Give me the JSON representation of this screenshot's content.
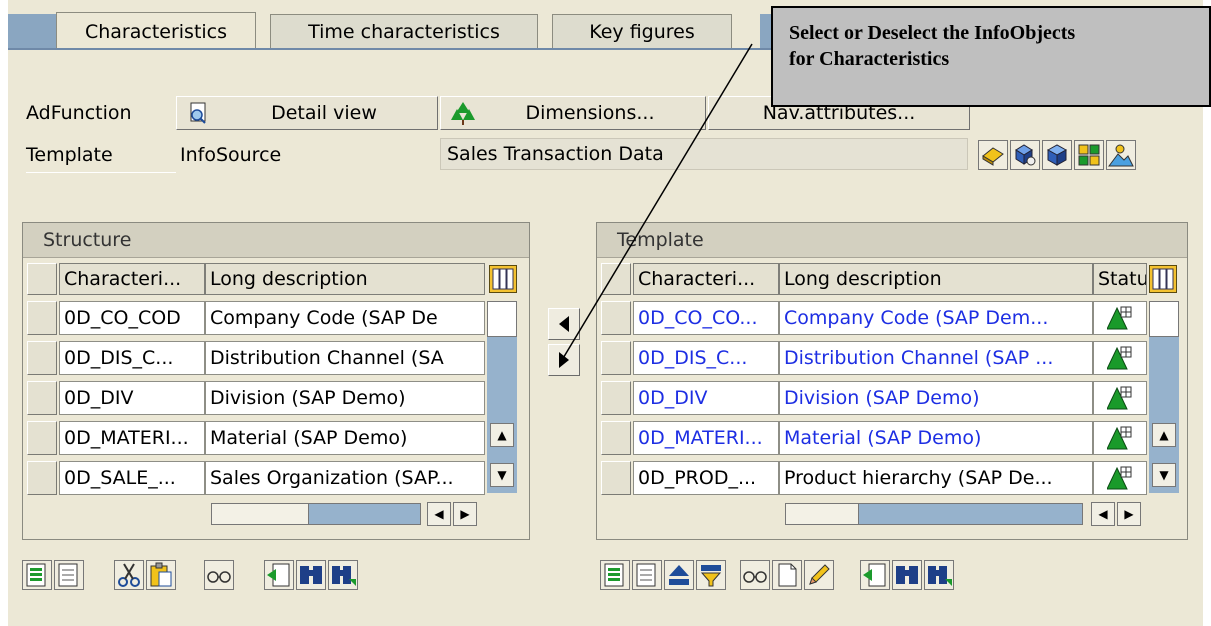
{
  "tabs": [
    {
      "label": "Characteristics",
      "active": true
    },
    {
      "label": "Time characteristics",
      "active": false
    },
    {
      "label": "Key figures",
      "active": false
    }
  ],
  "callout": {
    "line1": "Select or Deselect the InfoObjects",
    "line2": "for Characteristics"
  },
  "adfunction": {
    "label": "AdFunction",
    "detail_view": "Detail view",
    "dimensions": "Dimensions...",
    "nav_attributes": "Nav.attributes..."
  },
  "template_row": {
    "label": "Template",
    "type": "InfoSource",
    "value": "Sales Transaction Data"
  },
  "structure": {
    "title": "Structure",
    "columns": [
      "Characteri...",
      "Long description"
    ],
    "rows": [
      [
        "0D_CO_COD",
        "Company Code (SAP De"
      ],
      [
        "0D_DIS_C...",
        "Distribution Channel (SA"
      ],
      [
        "0D_DIV",
        "Division (SAP Demo)"
      ],
      [
        "0D_MATERI...",
        "Material (SAP Demo)"
      ],
      [
        "0D_SALE_...",
        "Sales Organization (SAP..."
      ]
    ]
  },
  "template_table": {
    "title": "Template",
    "columns": [
      "Characteri...",
      "Long description",
      "Statu"
    ],
    "rows": [
      [
        "0D_CO_CO...",
        "Company Code (SAP Dem..."
      ],
      [
        "0D_DIS_C...",
        "Distribution Channel (SAP ..."
      ],
      [
        "0D_DIV",
        "Division (SAP Demo)"
      ],
      [
        "0D_MATERI...",
        "Material (SAP Demo)"
      ],
      [
        "0D_PROD_...",
        "Product hierarchy (SAP De..."
      ]
    ]
  },
  "colors": {
    "panel": "#ece8d6",
    "accent_blue": "#8aa6c1",
    "link_blue": "#1d2ee3",
    "status_green": "#1a9a2a"
  }
}
